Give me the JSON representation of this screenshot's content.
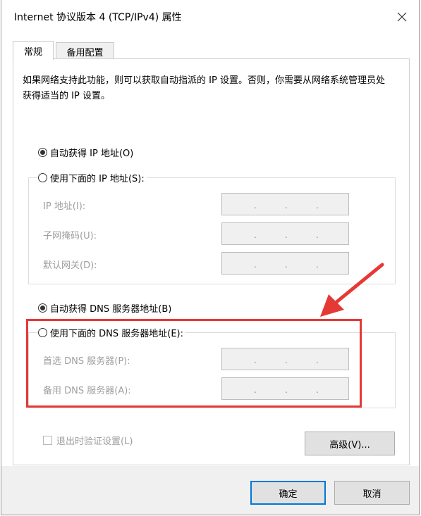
{
  "window": {
    "title": "Internet 协议版本 4 (TCP/IPv4) 属性"
  },
  "tabs": [
    {
      "label": "常规"
    },
    {
      "label": "备用配置"
    }
  ],
  "description": "如果网络支持此功能，则可以获取自动指派的 IP 设置。否则，你需要从网络系统管理员处获得适当的 IP 设置。",
  "ip": {
    "auto_label": "自动获得 IP 地址(O)",
    "manual_label": "使用下面的 IP 地址(S):",
    "auto_selected": true,
    "fields": [
      {
        "label": "IP 地址(I):"
      },
      {
        "label": "子网掩码(U):"
      },
      {
        "label": "默认网关(D):"
      }
    ]
  },
  "dns": {
    "auto_label": "自动获得 DNS 服务器地址(B)",
    "manual_label": "使用下面的 DNS 服务器地址(E):",
    "auto_selected": true,
    "fields": [
      {
        "label": "首选 DNS 服务器(P):"
      },
      {
        "label": "备用 DNS 服务器(A):"
      }
    ]
  },
  "ip_dot": ".",
  "validate_label": "退出时验证设置(L)",
  "advanced_label": "高级(V)...",
  "ok_label": "确定",
  "cancel_label": "取消",
  "colors": {
    "highlight": "#e53935",
    "focus": "#0078d7",
    "disabled_text": "#9e9e9e"
  }
}
